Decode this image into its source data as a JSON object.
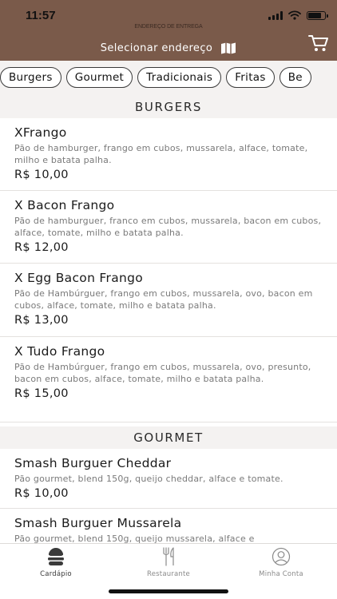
{
  "status_bar": {
    "time": "11:57",
    "battery_level": 0.85
  },
  "header": {
    "delivery_caption": "ENDEREÇO DE ENTREGA",
    "address_label": "Selecionar endereço",
    "address_icon": "map-icon",
    "cart_icon": "cart-icon"
  },
  "categories": [
    "Burgers",
    "Gourmet",
    "Tradicionais",
    "Fritas",
    "Be"
  ],
  "sections": [
    {
      "title": "BURGERS",
      "items": [
        {
          "name": "XFrango",
          "description": "Pão de hamburger, frango em cubos, mussarela, alface, tomate, milho e batata palha.",
          "price": "R$ 10,00"
        },
        {
          "name": "X Bacon Frango",
          "description": "Pão de hamburguer, franco em cubos, mussarela, bacon em cubos, alface, tomate, milho e batata palha.",
          "price": "R$ 12,00"
        },
        {
          "name": "X Egg Bacon Frango",
          "description": "Pão de Hambúrguer, frango em cubos, mussarela, ovo, bacon em cubos, alface, tomate, milho e batata palha.",
          "price": "R$ 13,00"
        },
        {
          "name": "X Tudo Frango",
          "description": "Pão de Hambúrguer, frango em cubos, mussarela, ovo, presunto, bacon em cubos, alface, tomate, milho e batata palha.",
          "price": "R$ 15,00"
        }
      ]
    },
    {
      "title": "GOURMET",
      "items": [
        {
          "name": "Smash Burguer Cheddar",
          "description": "Pão gourmet, blend 150g, queijo cheddar, alface e tomate.",
          "price": "R$ 10,00"
        },
        {
          "name": "Smash Burguer Mussarela",
          "description": "Pão gourmet, blend 150g, queijo mussarela, alface e",
          "price": ""
        }
      ]
    }
  ],
  "tabbar": {
    "tabs": [
      {
        "label": "Cardápio",
        "icon": "menu-burger-icon",
        "active": true
      },
      {
        "label": "Restaurante",
        "icon": "cutlery-icon",
        "active": false
      },
      {
        "label": "Minha Conta",
        "icon": "user-icon",
        "active": false
      }
    ]
  },
  "colors": {
    "header_brown": "#7a5a4a",
    "section_background": "#f4f2f1",
    "text_primary": "#1a1a1a",
    "text_secondary": "#7a7a7a"
  }
}
